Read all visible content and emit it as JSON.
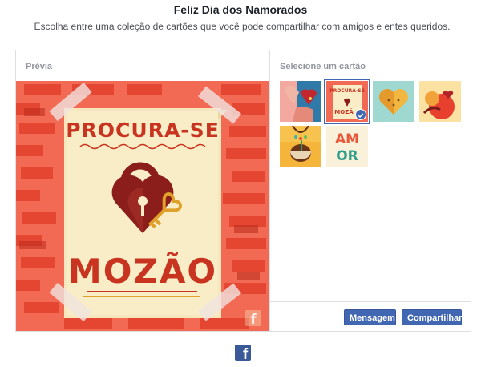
{
  "header": {
    "title": "Feliz Dia dos Namorados",
    "subtitle": "Escolha entre uma coleção de cartões que você pode compartilhar com amigos e entes queridos."
  },
  "preview": {
    "label": "Prévia",
    "card_top_text": "PROCURA-SE",
    "card_bottom_text": "MOZÃO"
  },
  "selector": {
    "label": "Selecione um cartão",
    "thumb_top_text": "PROCURA-SE",
    "thumb_bottom_text": "MOZÃ",
    "amor_text": [
      "AM",
      "OR"
    ],
    "selected_index": 1
  },
  "actions": {
    "message_label": "Mensagem",
    "share_label": "Compartilhar"
  },
  "brand": {
    "logo": "facebook-icon",
    "glyph": "f"
  },
  "colors": {
    "accent": "#4267b2",
    "brick_background": "#f26a53",
    "card_red": "#c8341f"
  }
}
